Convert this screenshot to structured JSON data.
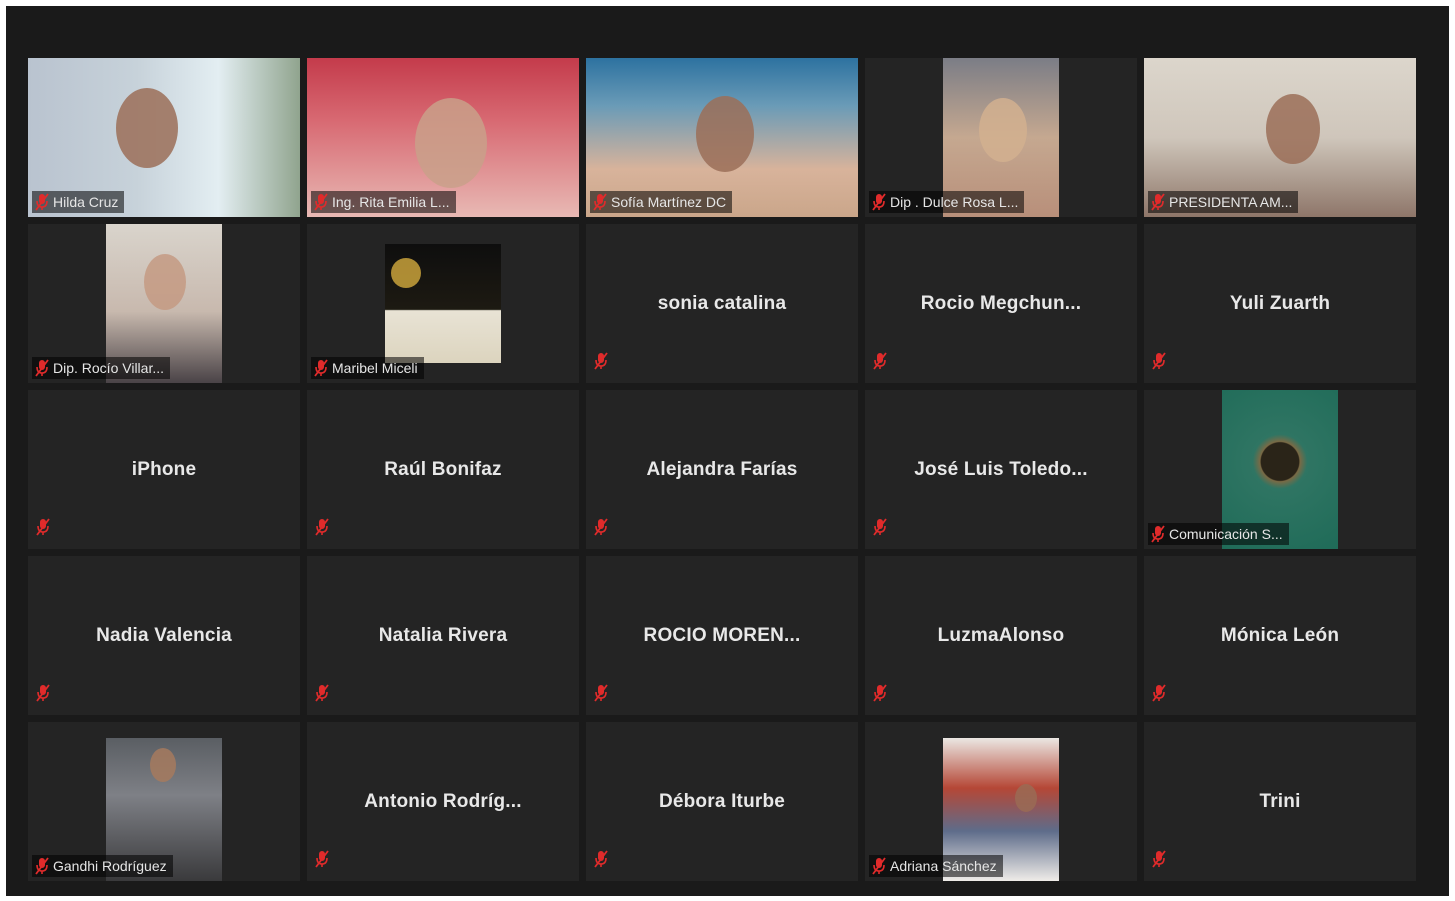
{
  "participants": [
    {
      "name": "Hilda Cruz",
      "video": true,
      "tag": true
    },
    {
      "name": "Ing. Rita Emilia L...",
      "video": true,
      "tag": true
    },
    {
      "name": "Sofía Martínez DC",
      "video": true,
      "tag": true
    },
    {
      "name": "Dip . Dulce Rosa L...",
      "video": true,
      "tag": true
    },
    {
      "name": "PRESIDENTA AM...",
      "video": true,
      "tag": true
    },
    {
      "name": "Dip. Rocío Villar...",
      "video": true,
      "tag": true
    },
    {
      "name": "Maribel Miceli",
      "video": true,
      "tag": true
    },
    {
      "name": "sonia catalina",
      "video": false
    },
    {
      "name": "Rocio Megchun...",
      "video": false
    },
    {
      "name": "Yuli Zuarth",
      "video": false
    },
    {
      "name": "iPhone",
      "video": false
    },
    {
      "name": "Raúl Bonifaz",
      "video": false
    },
    {
      "name": "Alejandra Farías",
      "video": false
    },
    {
      "name": "José Luis Toledo...",
      "video": false
    },
    {
      "name": "Comunicación S...",
      "video": true,
      "tag": true
    },
    {
      "name": "Nadia Valencia",
      "video": false
    },
    {
      "name": "Natalia Rivera",
      "video": false
    },
    {
      "name": "ROCIO MOREN...",
      "video": false
    },
    {
      "name": "LuzmaAlonso",
      "video": false
    },
    {
      "name": "Mónica León",
      "video": false
    },
    {
      "name": "Gandhi Rodríguez",
      "video": true,
      "tag": true
    },
    {
      "name": "Antonio Rodríg...",
      "video": false
    },
    {
      "name": "Débora Iturbe",
      "video": false
    },
    {
      "name": "Adriana Sánchez",
      "video": true,
      "tag": true
    },
    {
      "name": "Trini",
      "video": false
    }
  ],
  "colors": {
    "background": "#1a1a1a",
    "tile": "#242424",
    "muted_icon": "#e02b2b",
    "name_text": "#e8e8e8"
  },
  "icons": {
    "muted": "mic-muted-icon"
  }
}
